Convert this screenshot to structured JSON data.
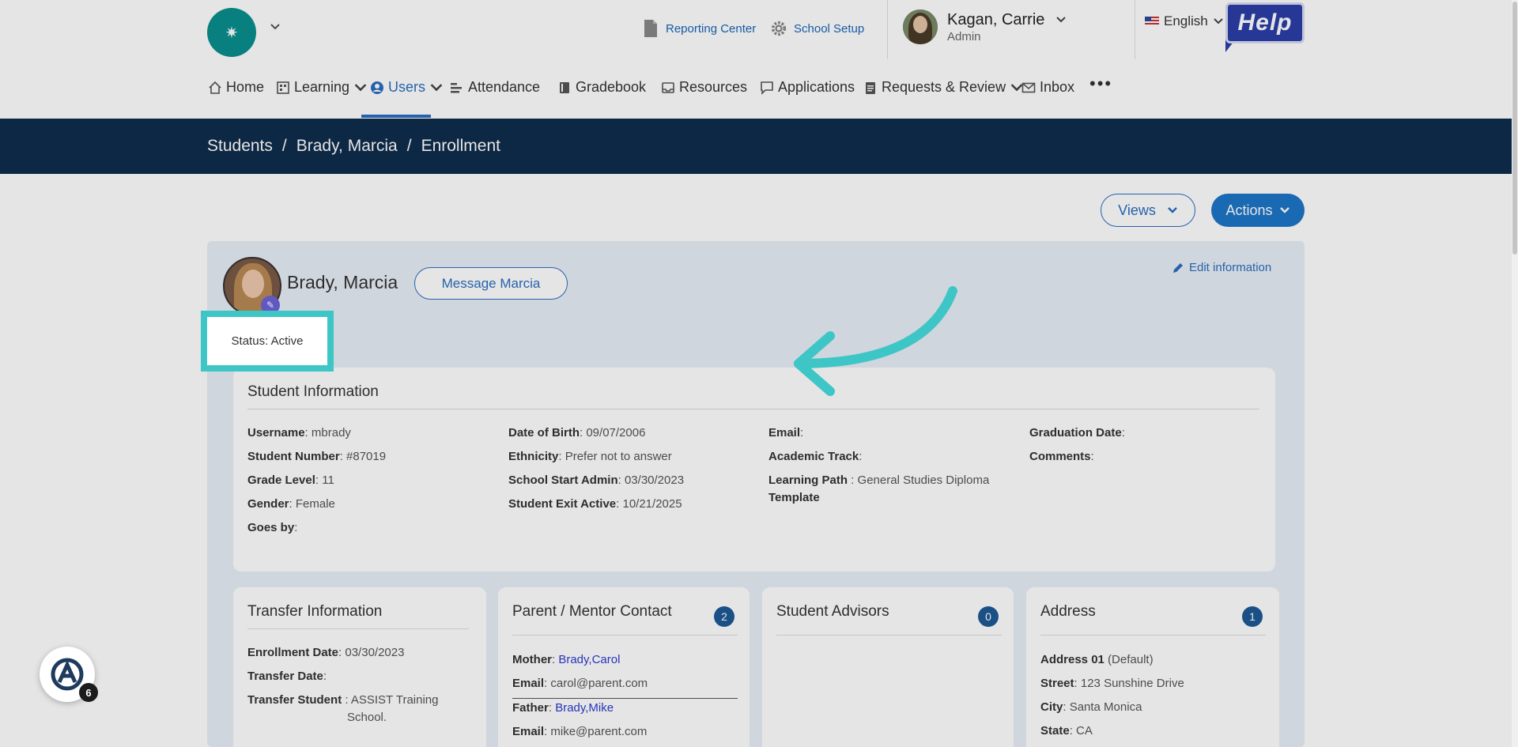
{
  "header": {
    "reporting_center": "Reporting Center",
    "school_setup": "School Setup",
    "user_name": "Kagan, Carrie",
    "user_role": "Admin",
    "language": "English",
    "help_label": "Help"
  },
  "nav": {
    "items": [
      {
        "label": "Home"
      },
      {
        "label": "Learning"
      },
      {
        "label": "Users"
      },
      {
        "label": "Attendance"
      },
      {
        "label": "Gradebook"
      },
      {
        "label": "Resources"
      },
      {
        "label": "Applications"
      },
      {
        "label": "Requests & Review"
      },
      {
        "label": "Inbox"
      }
    ],
    "more": "•••"
  },
  "breadcrumb": {
    "items": [
      "Students",
      "Brady, Marcia",
      "Enrollment"
    ],
    "separator": "/"
  },
  "toolbar": {
    "views_label": "Views",
    "actions_label": "Actions"
  },
  "profile": {
    "name": "Brady, Marcia",
    "message_label": "Message Marcia",
    "edit_label": "Edit information",
    "status": "Status: Active"
  },
  "student_info": {
    "title": "Student Information",
    "col1": [
      {
        "label": "Username",
        "value": "mbrady"
      },
      {
        "label": "Student Number",
        "value": "#87019"
      },
      {
        "label": "Grade Level",
        "value": "11"
      },
      {
        "label": "Gender",
        "value": "Female"
      },
      {
        "label": "Goes by",
        "value": ""
      }
    ],
    "col2": [
      {
        "label": "Date of Birth",
        "value": "09/07/2006"
      },
      {
        "label": "Ethnicity",
        "value": "Prefer not to answer"
      },
      {
        "label": "School Start Admin",
        "value": "03/30/2023"
      },
      {
        "label": "Student Exit Active",
        "value": "10/21/2025"
      }
    ],
    "col3": [
      {
        "label": "Email",
        "value": ""
      },
      {
        "label": "Academic Track",
        "value": ""
      },
      {
        "label": "Learning Path",
        "value": "General Studies Diploma",
        "label_cont": "Template"
      }
    ],
    "col4": [
      {
        "label": "Graduation Date",
        "value": ""
      },
      {
        "label": "Comments",
        "value": ""
      }
    ]
  },
  "transfer": {
    "title": "Transfer Information",
    "enrollment_label": "Enrollment Date",
    "enrollment_value": "03/30/2023",
    "transfer_date_label": "Transfer Date",
    "transfer_date_value": "",
    "transfer_student_label": "Transfer Student",
    "transfer_student_value": "ASSIST Training",
    "transfer_student_value2": "School."
  },
  "parent": {
    "title": "Parent / Mentor Contact",
    "count": "2",
    "mother_label": "Mother",
    "mother_value": "Brady,Carol",
    "mother_email_label": "Email",
    "mother_email_value": "carol@parent.com",
    "father_label": "Father",
    "father_value": "Brady,Mike",
    "father_email_label": "Email",
    "father_email_value": "mike@parent.com"
  },
  "advisors": {
    "title": "Student Advisors",
    "count": "0"
  },
  "address": {
    "title": "Address",
    "count": "1",
    "address_label": "Address 01",
    "address_value": "(Default)",
    "street_label": "Street",
    "street_value": "123 Sunshine Drive",
    "city_label": "City",
    "city_value": "Santa Monica",
    "state_label": "State",
    "state_value": "CA"
  },
  "assistant": {
    "badge_count": "6"
  },
  "colors": {
    "nav_dark": "#0f2d4c",
    "accent_blue": "#2a6ec0",
    "highlight_teal": "#3ec6c6",
    "help_purple": "#2b3ea8"
  }
}
